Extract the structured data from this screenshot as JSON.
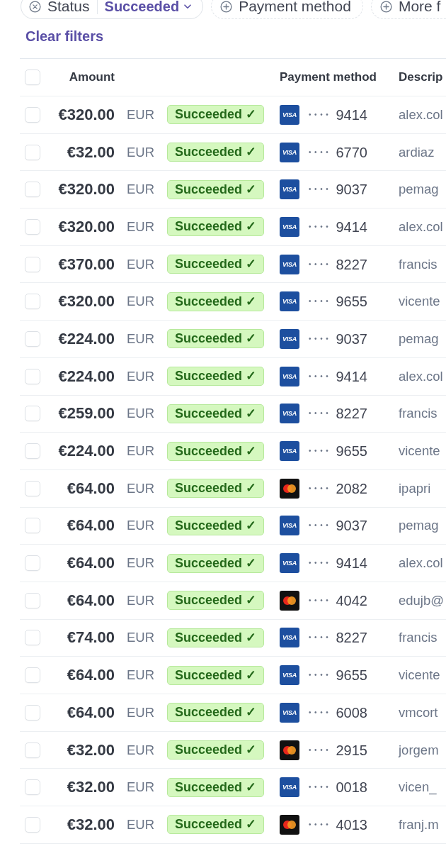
{
  "filters": {
    "chips": [
      {
        "kind": "applied",
        "label": "Status",
        "value": "Succeeded"
      },
      {
        "kind": "add",
        "label": "Payment method"
      },
      {
        "kind": "add",
        "label": "More f"
      }
    ],
    "clear_label": "Clear filters"
  },
  "table": {
    "select_all": {
      "checked": false
    },
    "headers": {
      "amount": "Amount",
      "payment_method": "Payment method",
      "column_6": "Descrip"
    },
    "rows": [
      {
        "selected": false,
        "amount": "€320.00",
        "currency": "EUR",
        "status": "Succeeded ✓",
        "card": {
          "kind": "visa",
          "mark": "VISA",
          "masked": "••••",
          "last4": "9414"
        },
        "column_6": "alex.col"
      },
      {
        "selected": false,
        "amount": "€32.00",
        "currency": "EUR",
        "status": "Succeeded ✓",
        "card": {
          "kind": "visa",
          "mark": "VISA",
          "masked": "••••",
          "last4": "6770"
        },
        "column_6": "ardiaz"
      },
      {
        "selected": false,
        "amount": "€320.00",
        "currency": "EUR",
        "status": "Succeeded ✓",
        "card": {
          "kind": "visa",
          "mark": "VISA",
          "masked": "••••",
          "last4": "9037"
        },
        "column_6": "pemag"
      },
      {
        "selected": false,
        "amount": "€320.00",
        "currency": "EUR",
        "status": "Succeeded ✓",
        "card": {
          "kind": "visa",
          "mark": "VISA",
          "masked": "••••",
          "last4": "9414"
        },
        "column_6": "alex.col"
      },
      {
        "selected": false,
        "amount": "€370.00",
        "currency": "EUR",
        "status": "Succeeded ✓",
        "card": {
          "kind": "visa",
          "mark": "VISA",
          "masked": "••••",
          "last4": "8227"
        },
        "column_6": "francis"
      },
      {
        "selected": false,
        "amount": "€320.00",
        "currency": "EUR",
        "status": "Succeeded ✓",
        "card": {
          "kind": "visa",
          "mark": "VISA",
          "masked": "••••",
          "last4": "9655"
        },
        "column_6": "vicente"
      },
      {
        "selected": false,
        "amount": "€224.00",
        "currency": "EUR",
        "status": "Succeeded ✓",
        "card": {
          "kind": "visa",
          "mark": "VISA",
          "masked": "••••",
          "last4": "9037"
        },
        "column_6": "pemag"
      },
      {
        "selected": false,
        "amount": "€224.00",
        "currency": "EUR",
        "status": "Succeeded ✓",
        "card": {
          "kind": "visa",
          "mark": "VISA",
          "masked": "••••",
          "last4": "9414"
        },
        "column_6": "alex.col"
      },
      {
        "selected": false,
        "amount": "€259.00",
        "currency": "EUR",
        "status": "Succeeded ✓",
        "card": {
          "kind": "visa",
          "mark": "VISA",
          "masked": "••••",
          "last4": "8227"
        },
        "column_6": "francis"
      },
      {
        "selected": false,
        "amount": "€224.00",
        "currency": "EUR",
        "status": "Succeeded ✓",
        "card": {
          "kind": "visa",
          "mark": "VISA",
          "masked": "••••",
          "last4": "9655"
        },
        "column_6": "vicente"
      },
      {
        "selected": false,
        "amount": "€64.00",
        "currency": "EUR",
        "status": "Succeeded ✓",
        "card": {
          "kind": "mastercard",
          "masked": "••••",
          "last4": "2082"
        },
        "column_6": "ipapri"
      },
      {
        "selected": false,
        "amount": "€64.00",
        "currency": "EUR",
        "status": "Succeeded ✓",
        "card": {
          "kind": "visa",
          "mark": "VISA",
          "masked": "••••",
          "last4": "9037"
        },
        "column_6": "pemag"
      },
      {
        "selected": false,
        "amount": "€64.00",
        "currency": "EUR",
        "status": "Succeeded ✓",
        "card": {
          "kind": "visa",
          "mark": "VISA",
          "masked": "••••",
          "last4": "9414"
        },
        "column_6": "alex.col"
      },
      {
        "selected": false,
        "amount": "€64.00",
        "currency": "EUR",
        "status": "Succeeded ✓",
        "card": {
          "kind": "mastercard",
          "masked": "••••",
          "last4": "4042"
        },
        "column_6": "edujb@"
      },
      {
        "selected": false,
        "amount": "€74.00",
        "currency": "EUR",
        "status": "Succeeded ✓",
        "card": {
          "kind": "visa",
          "mark": "VISA",
          "masked": "••••",
          "last4": "8227"
        },
        "column_6": "francis"
      },
      {
        "selected": false,
        "amount": "€64.00",
        "currency": "EUR",
        "status": "Succeeded ✓",
        "card": {
          "kind": "visa",
          "mark": "VISA",
          "masked": "••••",
          "last4": "9655"
        },
        "column_6": "vicente"
      },
      {
        "selected": false,
        "amount": "€64.00",
        "currency": "EUR",
        "status": "Succeeded ✓",
        "card": {
          "kind": "visa",
          "mark": "VISA",
          "masked": "••••",
          "last4": "6008"
        },
        "column_6": "vmcort"
      },
      {
        "selected": false,
        "amount": "€32.00",
        "currency": "EUR",
        "status": "Succeeded ✓",
        "card": {
          "kind": "mastercard",
          "masked": "••••",
          "last4": "2915"
        },
        "column_6": "jorgem"
      },
      {
        "selected": false,
        "amount": "€32.00",
        "currency": "EUR",
        "status": "Succeeded ✓",
        "card": {
          "kind": "visa",
          "mark": "VISA",
          "masked": "••••",
          "last4": "0018"
        },
        "column_6": "vicen_"
      },
      {
        "selected": false,
        "amount": "€32.00",
        "currency": "EUR",
        "status": "Succeeded ✓",
        "card": {
          "kind": "mastercard",
          "masked": "••••",
          "last4": "4013"
        },
        "column_6": "franj.m"
      }
    ]
  }
}
